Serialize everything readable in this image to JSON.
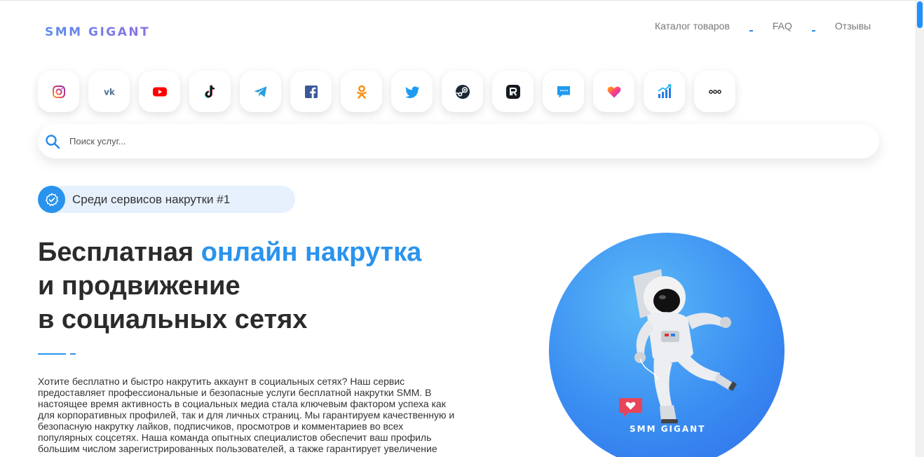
{
  "header": {
    "logo": "SMM GIGANT",
    "nav": [
      {
        "label": "Каталог товаров"
      },
      {
        "label": "FAQ"
      },
      {
        "label": "Отзывы"
      }
    ]
  },
  "socials": [
    {
      "name": "instagram-icon"
    },
    {
      "name": "vk-icon"
    },
    {
      "name": "youtube-icon"
    },
    {
      "name": "tiktok-icon"
    },
    {
      "name": "telegram-icon"
    },
    {
      "name": "facebook-icon"
    },
    {
      "name": "odnoklassniki-icon"
    },
    {
      "name": "twitter-icon"
    },
    {
      "name": "steam-icon"
    },
    {
      "name": "rutube-icon"
    },
    {
      "name": "chat-icon"
    },
    {
      "name": "likee-icon"
    },
    {
      "name": "stats-icon"
    },
    {
      "name": "more-icon"
    }
  ],
  "search": {
    "placeholder": "Поиск услуг...",
    "value": ""
  },
  "badge": {
    "text": "Среди сервисов накрутки #1"
  },
  "hero": {
    "title_part1": "Бесплатная ",
    "title_accent": "онлайн накрутка",
    "title_line2": "и продвижение",
    "title_line3": "в социальных сетях",
    "description": "Хотите бесплатно и быстро накрутить аккаунт в социальных сетях? Наш сервис предоставляет профессиональные и безопасные услуги бесплатной накрутки SMM. В настоящее время активность в социальных медиа стала ключевым фактором успеха как для корпоративных профилей, так и для личных страниц. Мы гарантируем качественную и безопасную накрутку лайков, подписчиков, просмотров и комментариев во всех популярных соцсетях. Наша команда опытных специалистов обеспечит ваш профиль большим числом зарегистрированных пользователей, а также гарантирует увеличение"
  },
  "illustration": {
    "brand": "SMM GIGANT"
  },
  "colors": {
    "accent": "#2a93ee",
    "text": "#2b2b2b"
  }
}
